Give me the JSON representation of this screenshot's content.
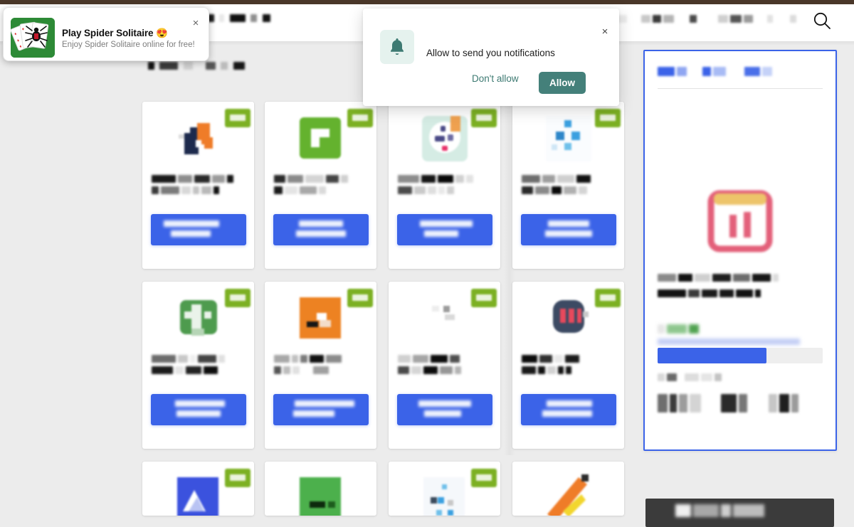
{
  "browser": {
    "chrome_color": "#4a3729"
  },
  "theme": {
    "page_bg": "#ececec",
    "card_bg": "#ffffff",
    "accent_blue": "#3b63e8",
    "badge_green": "#7cb023",
    "dialog_teal": "#44807a",
    "panel_border": "#3b63e8",
    "banner_dark": "#3b3b3b"
  },
  "toast": {
    "title": "Play Spider Solitaire 😍",
    "subtitle": "Enjoy Spider Solitaire online for free!",
    "close_label": "×",
    "icon": "spider-solitaire-cards-icon"
  },
  "notification_dialog": {
    "message": "Allow to send you notifications",
    "deny_label": "Don't allow",
    "allow_label": "Allow",
    "close_label": "×",
    "icon": "bell-icon"
  },
  "header": {
    "logo": "site-logo",
    "search_icon": "search-icon",
    "nav_items": [
      {
        "name": "nav-item-1",
        "widths": [
          10
        ]
      },
      {
        "name": "nav-item-2",
        "widths": [
          11
        ]
      },
      {
        "name": "nav-item-3",
        "widths": [
          9,
          17
        ]
      },
      {
        "name": "nav-item-4",
        "widths": [
          13,
          12,
          15
        ]
      },
      {
        "name": "nav-item-5",
        "widths": [
          10
        ]
      },
      {
        "name": "nav-item-6",
        "widths": [
          14,
          16,
          13,
          9
        ]
      },
      {
        "name": "nav-item-7",
        "widths": [
          8
        ]
      },
      {
        "name": "nav-item-8",
        "widths": [
          9
        ]
      }
    ]
  },
  "page_heading": {
    "words": [
      9,
      26,
      6,
      14,
      10,
      16
    ]
  },
  "grid": {
    "columns": 4,
    "cards": [
      {
        "name": "app-card-1",
        "icon": "hand-pointer-orange-icon",
        "icon_colors": [
          "#1d2a4d",
          "#ef7c28"
        ],
        "badge": true
      },
      {
        "name": "app-card-2",
        "icon": "green-rounded-square-icon",
        "icon_colors": [
          "#64b22e",
          "#ffffff"
        ],
        "badge": true
      },
      {
        "name": "app-card-3",
        "icon": "mint-face-icon",
        "icon_colors": [
          "#d5ece4",
          "#4b4a87"
        ],
        "badge": true
      },
      {
        "name": "app-card-4",
        "icon": "blue-dots-icon",
        "icon_colors": [
          "#3ba0e0",
          "#ffffff"
        ],
        "badge": true
      },
      {
        "name": "app-card-5",
        "icon": "green-creature-icon",
        "icon_colors": [
          "#4e9b4e",
          "#eaf3ea"
        ],
        "badge": true
      },
      {
        "name": "app-card-6",
        "icon": "orange-square-icon",
        "icon_colors": [
          "#ed8222",
          "#ffffff"
        ],
        "badge": true
      },
      {
        "name": "app-card-7",
        "icon": "faint-gray-icon",
        "icon_colors": [
          "#d9d9d9",
          "#9b9b9b"
        ],
        "badge": true
      },
      {
        "name": "app-card-8",
        "icon": "navy-bug-red-stripes-icon",
        "icon_colors": [
          "#3c4a63",
          "#e8495c"
        ],
        "badge": true
      },
      {
        "name": "app-card-9",
        "icon": "blue-mountain-icon",
        "icon_colors": [
          "#3b52de",
          "#ffffff"
        ],
        "badge": true
      },
      {
        "name": "app-card-10",
        "icon": "green-square-icon",
        "icon_colors": [
          "#4cb04c",
          "#0d2a0d"
        ],
        "badge": false
      },
      {
        "name": "app-card-11",
        "icon": "light-blue-dots-icon",
        "icon_colors": [
          "#f2f6fa",
          "#3ba0e0"
        ],
        "badge": true
      },
      {
        "name": "app-card-12",
        "icon": "orange-yellow-tool-icon",
        "icon_colors": [
          "#ef7c28",
          "#f2d62e"
        ],
        "badge": false
      }
    ],
    "title_line_1_words": [
      34,
      8,
      24,
      6,
      18,
      5,
      14
    ],
    "title_line_2_words": [
      10,
      6,
      30,
      5,
      12,
      7,
      16
    ],
    "cta_label_lines": 2
  },
  "side_panel": {
    "name": "detail-panel",
    "breadcrumb_words": [
      36,
      30,
      22,
      40,
      26,
      32
    ],
    "big_icon": "pink-calendar-bars-icon",
    "description_line_1_words": [
      26,
      10,
      22,
      8,
      20,
      30,
      18,
      8
    ],
    "description_line_2_words": [
      40,
      14,
      22,
      20,
      24,
      8
    ],
    "green_tag_words": [
      8,
      34,
      12
    ],
    "progress": {
      "percent": 66,
      "label_words": [
        200
      ]
    },
    "sub_caption_words": [
      8,
      14,
      22,
      18,
      10
    ],
    "thumbnails": 3
  },
  "bottom_banner": {
    "name": "bottom-dark-banner",
    "text_words": [
      26,
      38,
      14,
      44
    ]
  }
}
